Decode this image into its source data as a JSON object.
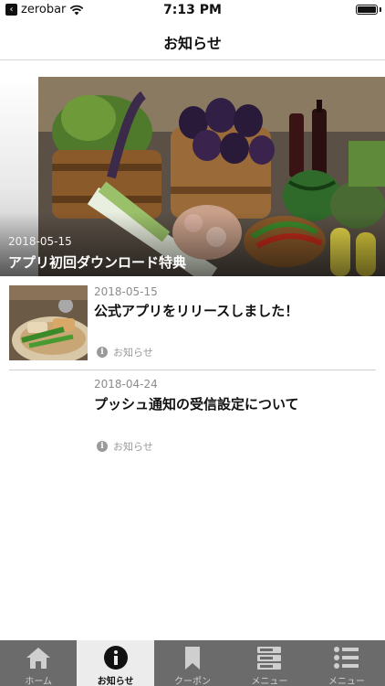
{
  "status_bar": {
    "back_app": "zerobar",
    "time": "7:13 PM"
  },
  "nav": {
    "title": "お知らせ"
  },
  "hero": {
    "date": "2018-05-15",
    "title": "アプリ初回ダウンロード特典"
  },
  "news": [
    {
      "date": "2018-05-15",
      "title": "公式アプリをリリースしました！",
      "category": "お知らせ"
    },
    {
      "date": "2018-04-24",
      "title": "プッシュ通知の受信設定について",
      "category": "お知らせ"
    }
  ],
  "tabs": [
    {
      "label": "ホーム",
      "icon": "home-icon"
    },
    {
      "label": "お知らせ",
      "icon": "info-icon"
    },
    {
      "label": "クーポン",
      "icon": "bookmark-icon"
    },
    {
      "label": "メニュー",
      "icon": "menu-card-icon"
    },
    {
      "label": "メニュー",
      "icon": "list-icon"
    }
  ],
  "colors": {
    "tab_bar": "#6b6b6b",
    "tab_active": "#ececec",
    "muted_text": "#8c8c8c"
  }
}
